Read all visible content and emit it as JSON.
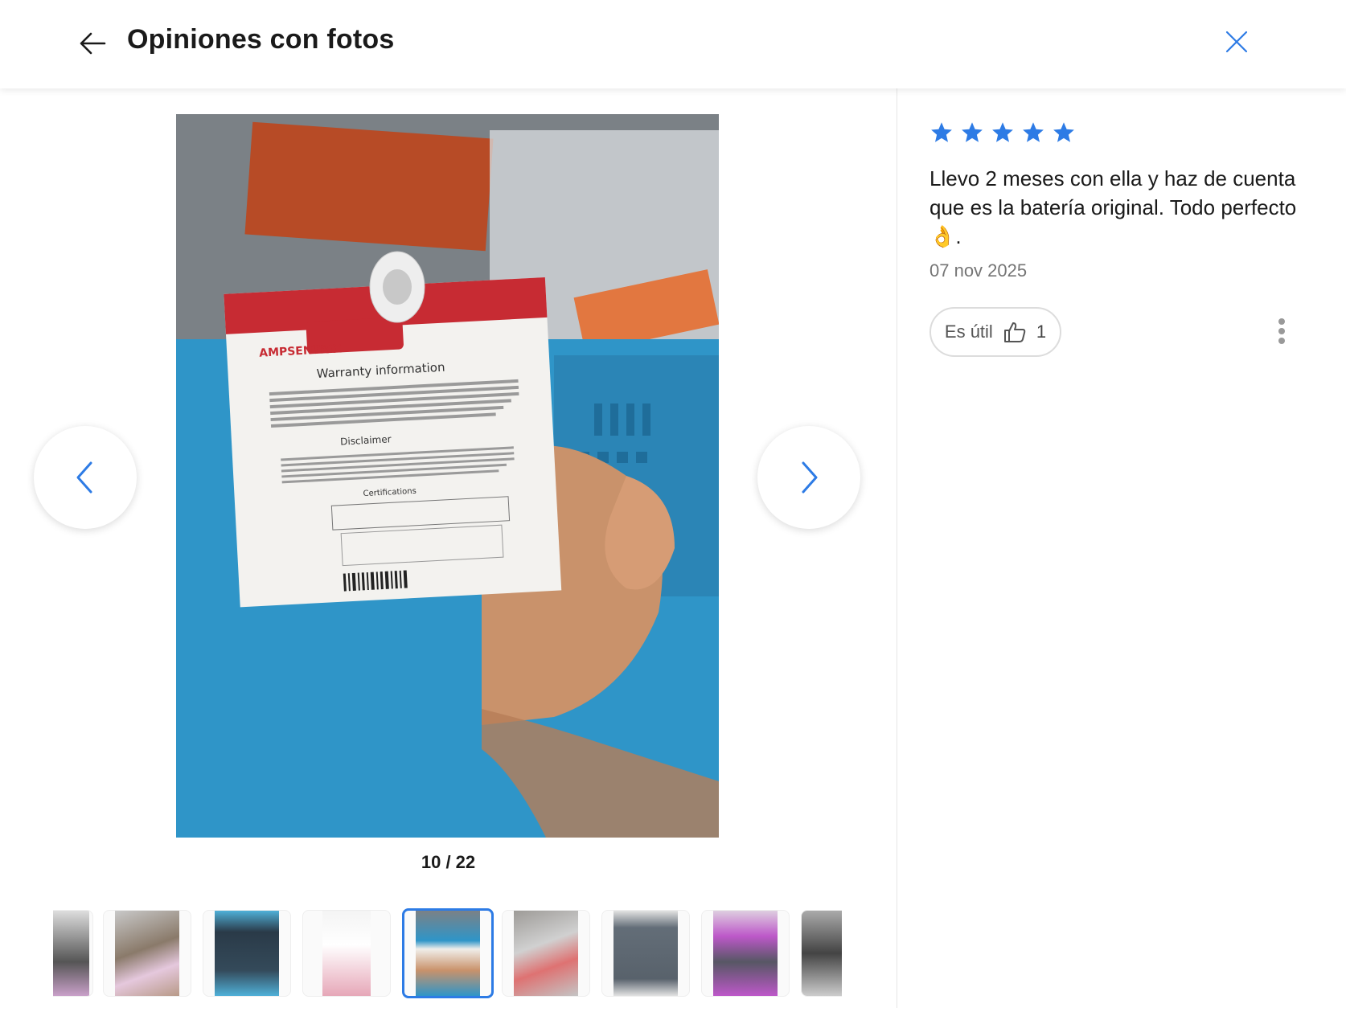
{
  "header": {
    "title": "Opiniones con fotos",
    "back_icon": "arrow-left-icon",
    "close_icon": "close-icon"
  },
  "gallery": {
    "current": 10,
    "total": 22,
    "counter_text": "10 / 22",
    "prev_icon": "chevron-left-icon",
    "next_icon": "chevron-right-icon",
    "photo_label_text": "AMPSENTRIX",
    "photo_heading_1": "Warranty information",
    "photo_heading_2": "Disclaimer",
    "photo_heading_3": "Certifications",
    "thumbnails_visible": 9,
    "active_thumbnail": 5
  },
  "review": {
    "rating": 5,
    "rating_max": 5,
    "text": "Llevo 2 meses con ella y haz de cuenta que es la batería original. Todo perfecto 👌.",
    "date": "07 nov 2025",
    "useful_label": "Es útil",
    "useful_count": "1",
    "useful_icon": "thumbs-up-icon",
    "more_icon": "more-vertical-icon"
  },
  "colors": {
    "accent": "#2d7be5",
    "star": "#2d7be5",
    "text": "#1a1a1a",
    "muted": "#757575"
  }
}
